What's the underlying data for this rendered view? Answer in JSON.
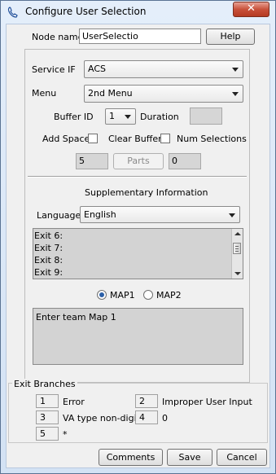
{
  "window": {
    "title": "Configure User Selection",
    "icon": "phone-icon",
    "close_label": "✕"
  },
  "node": {
    "label": "Node name",
    "value": "UserSelectio",
    "help": "Help"
  },
  "service": {
    "label": "Service IF",
    "value": "ACS"
  },
  "menu": {
    "label": "Menu",
    "value": "2nd Menu"
  },
  "buffer": {
    "label": "Buffer ID",
    "value": "1",
    "duration_label": "Duration",
    "duration_value": ""
  },
  "options": {
    "add_space": "Add Space",
    "clear_buffer": "Clear Buffer",
    "num_selections": "Num Selections"
  },
  "parts": {
    "left_value": "5",
    "button": "Parts",
    "right_value": "0"
  },
  "supplementary": {
    "title": "Supplementary Information",
    "language_label": "Language",
    "language_value": "English",
    "exits": [
      "Exit 6:",
      "Exit 7:",
      "Exit 8:",
      "Exit 9:"
    ],
    "map1": "MAP1",
    "map2": "MAP2",
    "selected_map": "MAP1",
    "text": "Enter team  Map 1"
  },
  "exit_branches": {
    "title": "Exit Branches",
    "items": [
      {
        "num": "1",
        "label": "Error"
      },
      {
        "num": "2",
        "label": "Improper User Input"
      },
      {
        "num": "3",
        "label": "VA type non-digit"
      },
      {
        "num": "4",
        "label": "0"
      },
      {
        "num": "5",
        "label": "*"
      }
    ]
  },
  "footer": {
    "comments": "Comments",
    "save": "Save",
    "cancel": "Cancel"
  }
}
